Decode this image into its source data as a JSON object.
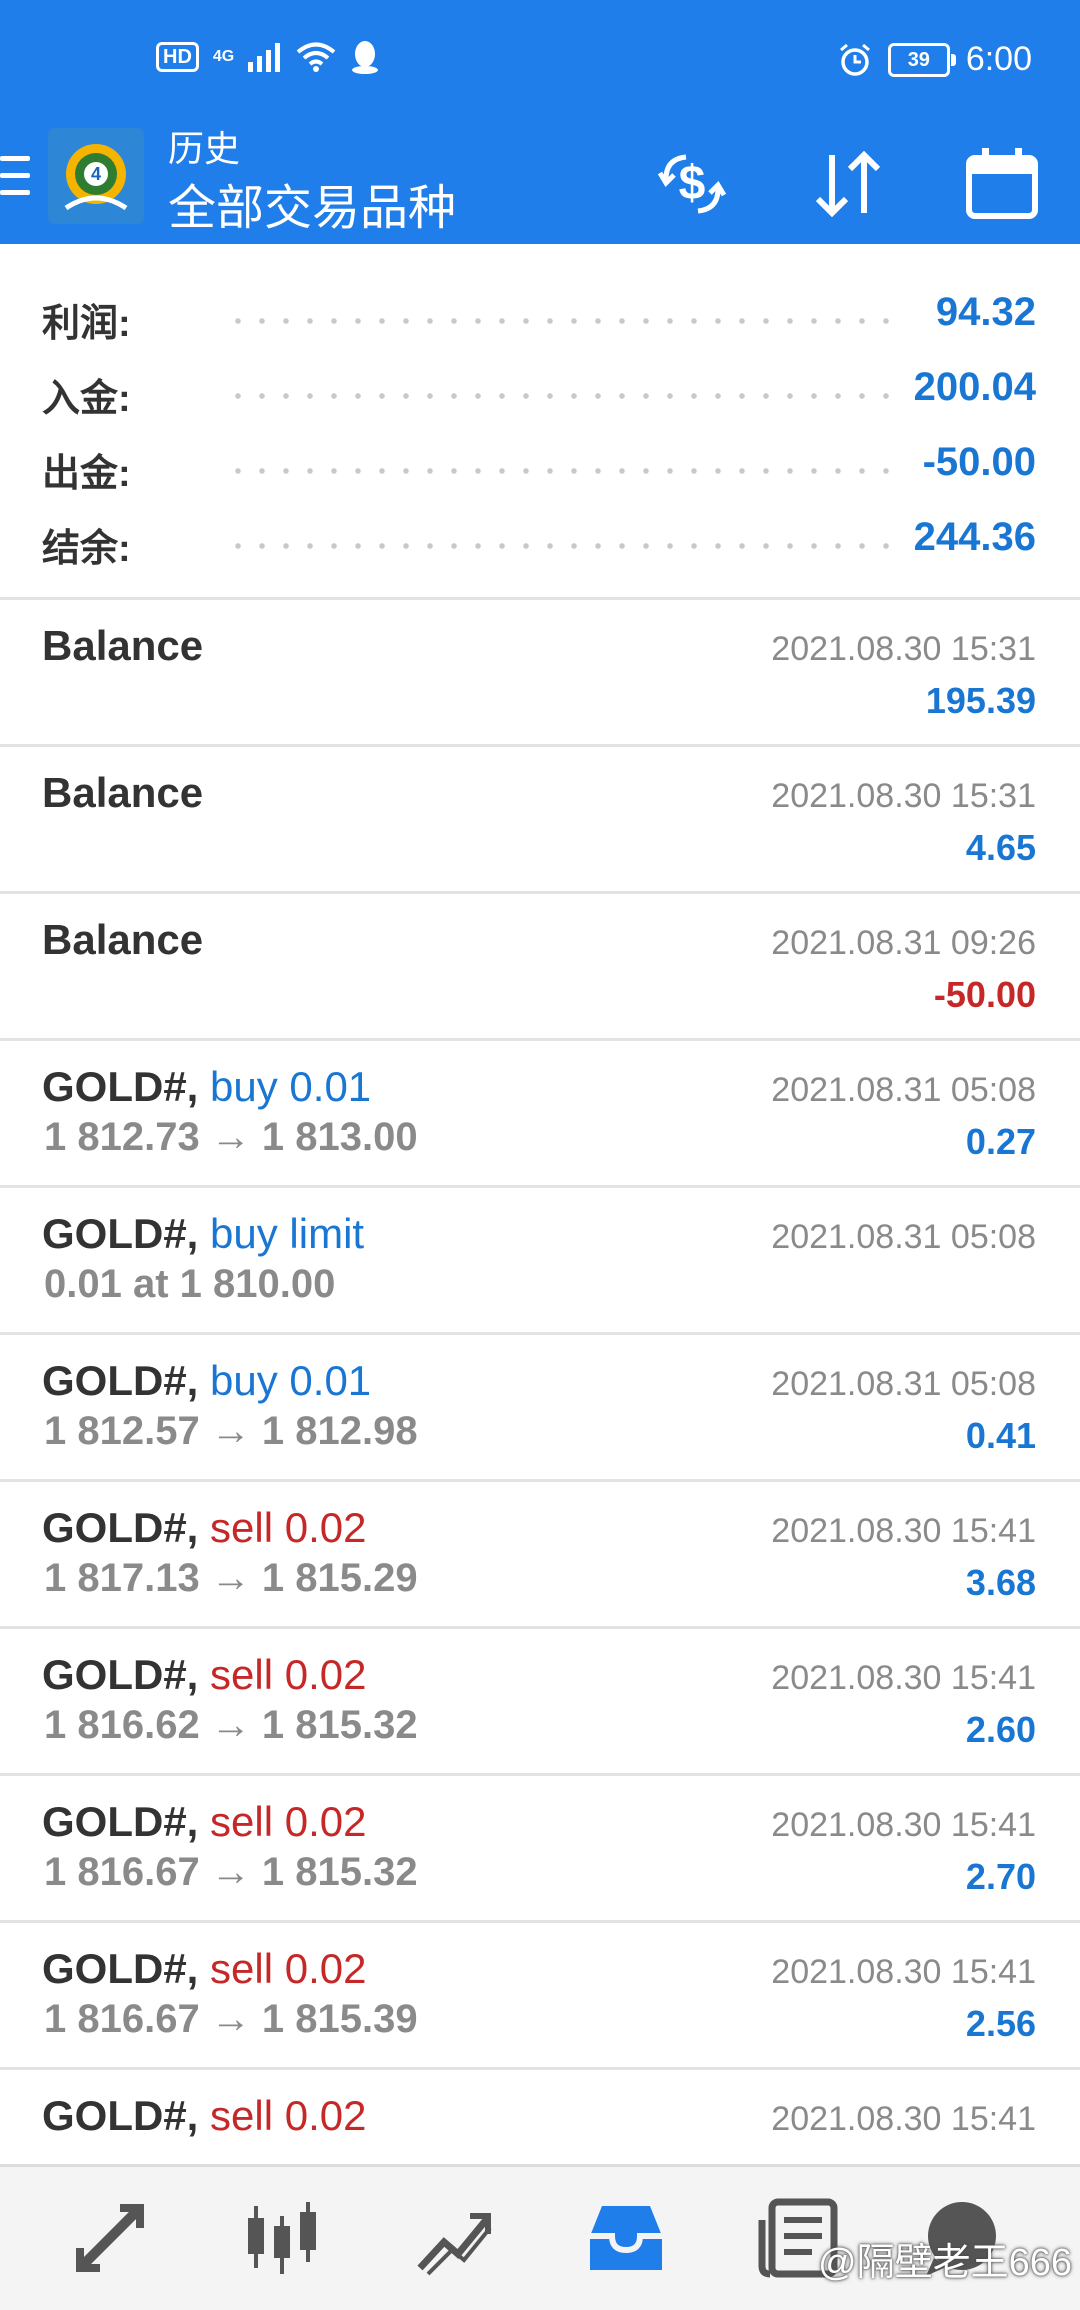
{
  "status_bar": {
    "left_badges": [
      "HD",
      "4G"
    ],
    "battery": "39",
    "time": "6:00"
  },
  "appbar": {
    "title_small": "历史",
    "title_big": "全部交易品种",
    "icons": [
      "menu-icon",
      "app-logo",
      "currency-exchange-icon",
      "sort-icon",
      "calendar-icon"
    ]
  },
  "summary": [
    {
      "label": "利润:",
      "value": "94.32"
    },
    {
      "label": "入金:",
      "value": "200.04"
    },
    {
      "label": "出金:",
      "value": "-50.00"
    },
    {
      "label": "结余:",
      "value": "244.36"
    }
  ],
  "rows": [
    {
      "symbol": "Balance",
      "action": "",
      "details": "",
      "time": "2021.08.30 15:31",
      "profit": "195.39"
    },
    {
      "symbol": "Balance",
      "action": "",
      "details": "",
      "time": "2021.08.30 15:31",
      "profit": "4.65"
    },
    {
      "symbol": "Balance",
      "action": "",
      "details": "",
      "time": "2021.08.31 09:26",
      "profit": "-50.00"
    },
    {
      "symbol": "GOLD#,",
      "action": "buy 0.01",
      "details": "1 812.73 → 1 813.00",
      "time": "2021.08.31 05:08",
      "profit": "0.27"
    },
    {
      "symbol": "GOLD#,",
      "action": "buy limit",
      "details": "0.01 at 1 810.00",
      "time": "2021.08.31 05:08",
      "profit": ""
    },
    {
      "symbol": "GOLD#,",
      "action": "buy 0.01",
      "details": "1 812.57 → 1 812.98",
      "time": "2021.08.31 05:08",
      "profit": "0.41"
    },
    {
      "symbol": "GOLD#,",
      "action": "sell 0.02",
      "details": "1 817.13 → 1 815.29",
      "time": "2021.08.30 15:41",
      "profit": "3.68"
    },
    {
      "symbol": "GOLD#,",
      "action": "sell 0.02",
      "details": "1 816.62 → 1 815.32",
      "time": "2021.08.30 15:41",
      "profit": "2.60"
    },
    {
      "symbol": "GOLD#,",
      "action": "sell 0.02",
      "details": "1 816.67 → 1 815.32",
      "time": "2021.08.30 15:41",
      "profit": "2.70"
    },
    {
      "symbol": "GOLD#,",
      "action": "sell 0.02",
      "details": "1 816.67 → 1 815.39",
      "time": "2021.08.30 15:41",
      "profit": "2.56"
    },
    {
      "symbol": "GOLD#,",
      "action": "sell 0.02",
      "details": "",
      "time": "2021.08.30 15:41",
      "profit": ""
    }
  ],
  "bottom_nav": {
    "items": [
      "quotes-icon",
      "chart-icon",
      "trade-icon",
      "history-icon",
      "news-icon",
      "chat-icon"
    ],
    "active": "history-icon"
  },
  "watermark": "@隔壁老王666",
  "colors": {
    "brand": "#1f7ee9",
    "positive": "#1976d2",
    "negative": "#c62828",
    "muted": "#8a8a8a"
  }
}
